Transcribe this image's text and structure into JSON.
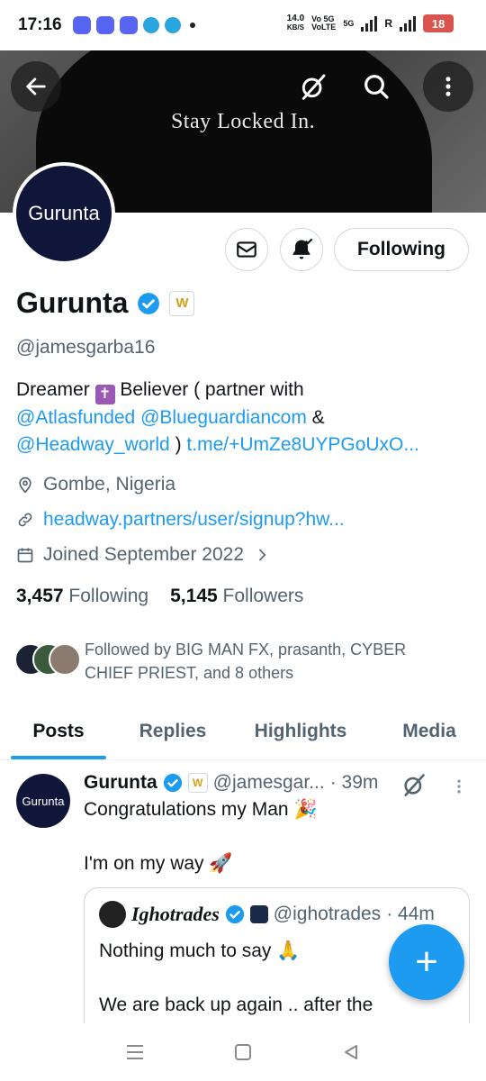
{
  "status_bar": {
    "time": "17:16",
    "net_speed_value": "14.0",
    "net_speed_unit": "KB/S",
    "volte_label": "Vo 5G",
    "volte_sub": "VoLTE",
    "signal_5g": "5G",
    "roaming": "R",
    "battery": "18"
  },
  "banner": {
    "text": "Stay Locked In.",
    "logo_text": "Gurunta"
  },
  "profile": {
    "display_name": "Gurunta",
    "handle": "@jamesgarba16",
    "follow_label": "Following",
    "bio_text_1": "Dreamer",
    "bio_cross": "✝",
    "bio_text_2": "Believer  ( partner with",
    "bio_mention_1": "@Atlasfunded",
    "bio_mention_2": "@Blueguardiancom",
    "bio_amp": " &",
    "bio_mention_3": "@Headway_world",
    "bio_paren": " ) ",
    "bio_link": "t.me/+UmZe8UYPGoUxO...",
    "location": "Gombe, Nigeria",
    "website": "headway.partners/user/signup?hw...",
    "joined": "Joined September 2022",
    "following_count": "3,457",
    "following_label": "Following",
    "followers_count": "5,145",
    "followers_label": "Followers",
    "followed_by": "Followed by BIG MAN FX, prasanth, CYBER CHIEF PRIEST, and 8 others"
  },
  "tabs": [
    {
      "label": "Posts"
    },
    {
      "label": "Replies"
    },
    {
      "label": "Highlights"
    },
    {
      "label": "Media"
    }
  ],
  "post": {
    "name": "Gurunta",
    "handle": "@jamesgar...",
    "time": "· 39m",
    "line1": "Congratulations my Man 🎉",
    "line2": "I'm on my way 🚀",
    "quote": {
      "name": "Ighotrades",
      "handle": "@ighotrades",
      "time": "· 44m",
      "line1": "Nothing much to say 🙏",
      "line2": "We are back up again .. after the"
    }
  },
  "fab_label": "+",
  "colors": {
    "accent": "#1d9bf0",
    "text": "#0f1419",
    "muted": "#536471"
  }
}
